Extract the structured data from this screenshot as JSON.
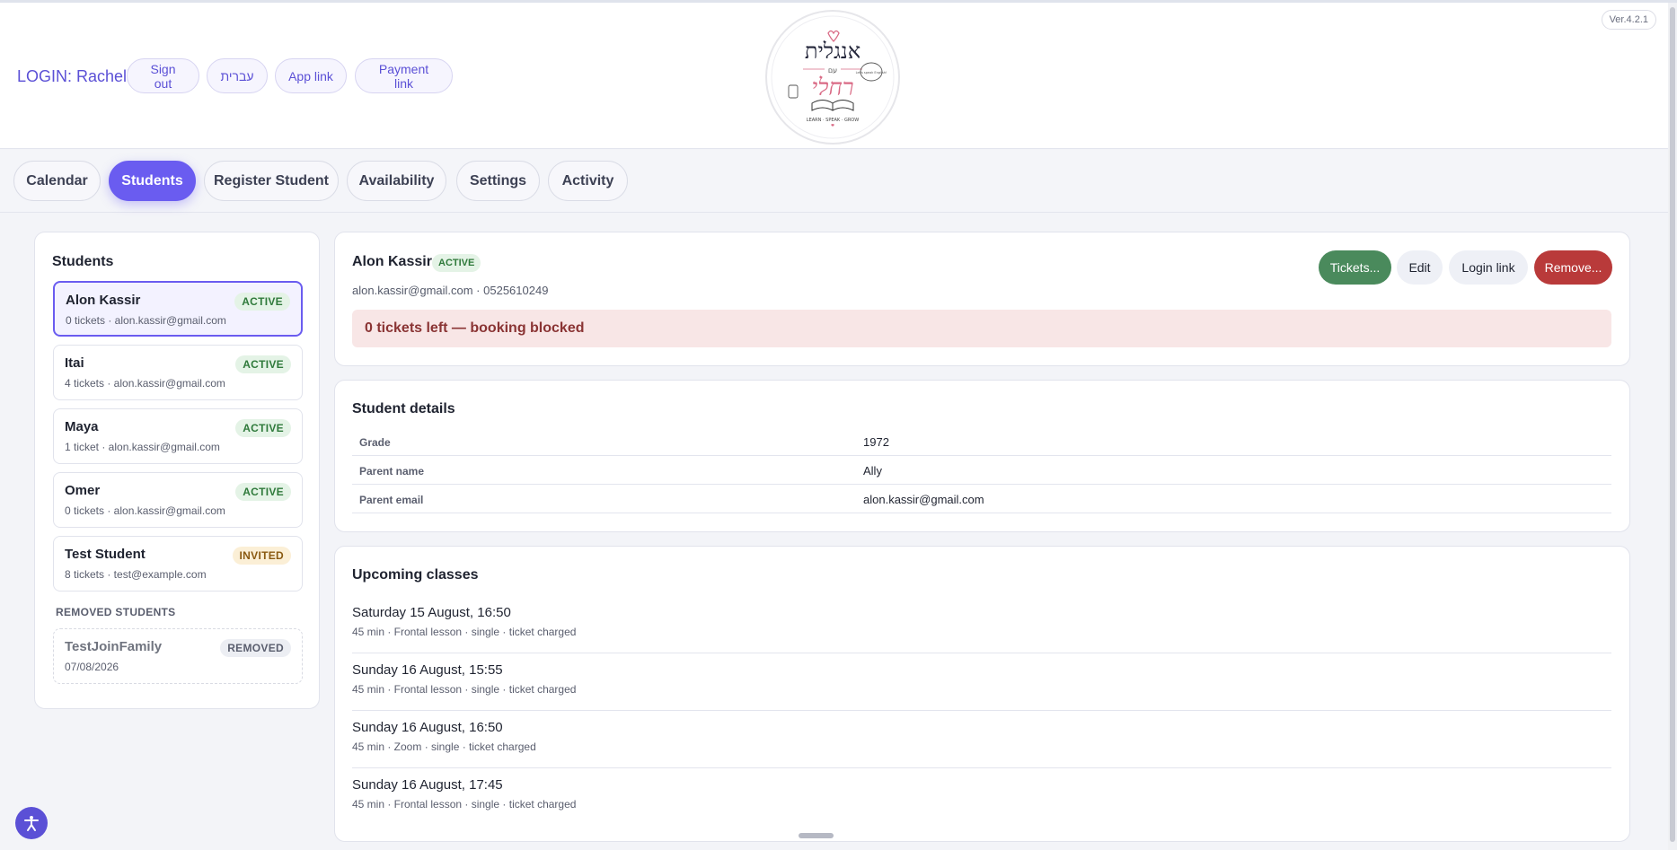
{
  "header": {
    "login_label": "LOGIN: Racheli",
    "buttons": [
      "Sign out",
      "עברית",
      "App link",
      "Payment link"
    ],
    "version": "Ver.4.2.1",
    "logo": {
      "title": "אנגלית",
      "with": "עם",
      "name": "רחלי",
      "speech": "Let's speak English!",
      "tagline": "LEARN · SPEAK · GROW"
    }
  },
  "tabs": [
    {
      "label": "Calendar",
      "active": false
    },
    {
      "label": "Students",
      "active": true
    },
    {
      "label": "Register Student",
      "active": false
    },
    {
      "label": "Availability",
      "active": false
    },
    {
      "label": "Settings",
      "active": false
    },
    {
      "label": "Activity",
      "active": false
    }
  ],
  "students_panel": {
    "title": "Students",
    "students": [
      {
        "name": "Alon Kassir",
        "sub": "0 tickets · alon.kassir@gmail.com",
        "status": "ACTIVE"
      },
      {
        "name": "Itai",
        "sub": "4 tickets · alon.kassir@gmail.com",
        "status": "ACTIVE"
      },
      {
        "name": "Maya",
        "sub": "1 ticket · alon.kassir@gmail.com",
        "status": "ACTIVE"
      },
      {
        "name": "Omer",
        "sub": "0 tickets · alon.kassir@gmail.com",
        "status": "ACTIVE"
      },
      {
        "name": "Test Student",
        "sub": "8 tickets · test@example.com",
        "status": "INVITED"
      }
    ],
    "removed_heading": "REMOVED STUDENTS",
    "removed": [
      {
        "name": "TestJoinFamily",
        "sub": "07/08/2026",
        "status": "REMOVED"
      }
    ]
  },
  "detail": {
    "name": "Alon Kassir",
    "status": "ACTIVE",
    "contact": "alon.kassir@gmail.com · 0525610249",
    "actions": {
      "tickets": "Tickets...",
      "edit": "Edit",
      "login_link": "Login link",
      "remove": "Remove..."
    },
    "alert": "0 tickets left — booking blocked"
  },
  "student_details": {
    "title": "Student details",
    "rows": [
      {
        "label": "Grade",
        "value": "1972"
      },
      {
        "label": "Parent name",
        "value": "Ally"
      },
      {
        "label": "Parent email",
        "value": "alon.kassir@gmail.com"
      }
    ]
  },
  "upcoming": {
    "title": "Upcoming classes",
    "classes": [
      {
        "title": "Saturday 15 August, 16:50",
        "sub": "45 min · Frontal lesson · single · ticket charged"
      },
      {
        "title": "Sunday 16 August, 15:55",
        "sub": "45 min · Frontal lesson · single · ticket charged"
      },
      {
        "title": "Sunday 16 August, 16:50",
        "sub": "45 min · Zoom · single · ticket charged"
      },
      {
        "title": "Sunday 16 August, 17:45",
        "sub": "45 min · Frontal lesson · single · ticket charged"
      }
    ]
  },
  "colors": {
    "accent": "#6a5cf0",
    "tickets_button": "#4a8a5c",
    "remove_button": "#b93a3a",
    "alert_bg": "#f8e6e6"
  },
  "icons": {
    "accessibility": "accessibility-icon"
  }
}
